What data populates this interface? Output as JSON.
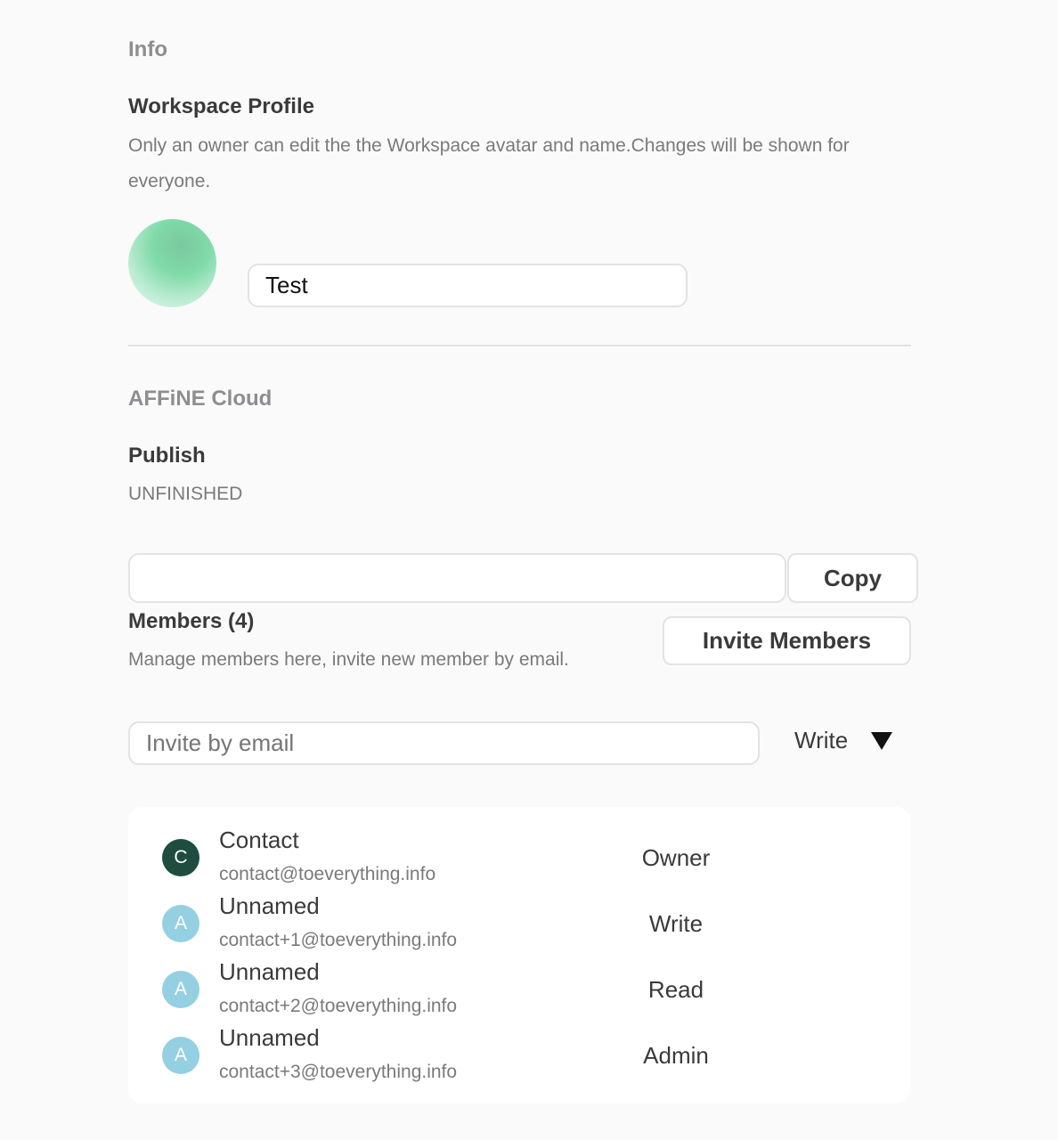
{
  "info": {
    "section_title": "Info"
  },
  "workspace_profile": {
    "title": "Workspace Profile",
    "description": "Only an owner can edit the the Workspace avatar and name.Changes will be shown for everyone.",
    "name_value": "Test"
  },
  "cloud": {
    "section_title": "AFFiNE Cloud",
    "publish_title": "Publish",
    "publish_status": "UNFINISHED",
    "link_value": "",
    "copy_label": "Copy"
  },
  "members": {
    "title": "Members (4)",
    "description": "Manage members here, invite new member by email.",
    "invite_button": "Invite Members",
    "invite_placeholder": "Invite by email",
    "permission_selected": "Write",
    "list": [
      {
        "initial": "C",
        "name": "Contact",
        "email": "contact@toeverything.info",
        "role": "Owner",
        "avatar_color": "#1e4d40"
      },
      {
        "initial": "A",
        "name": "Unnamed",
        "email": "contact+1@toeverything.info",
        "role": "Write",
        "avatar_color": "#94d0e2"
      },
      {
        "initial": "A",
        "name": "Unnamed",
        "email": "contact+2@toeverything.info",
        "role": "Read",
        "avatar_color": "#94d0e2"
      },
      {
        "initial": "A",
        "name": "Unnamed",
        "email": "contact+3@toeverything.info",
        "role": "Admin",
        "avatar_color": "#94d0e2"
      }
    ]
  }
}
